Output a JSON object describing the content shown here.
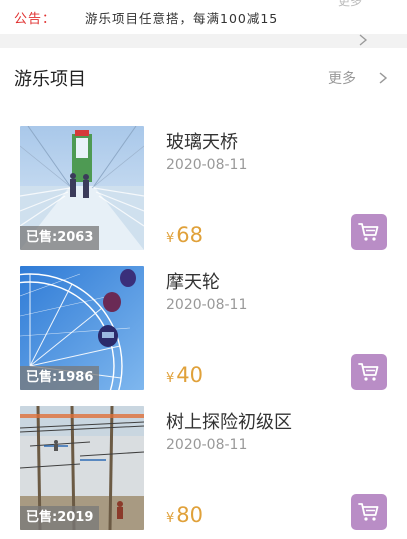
{
  "notice": {
    "label": "公告：",
    "text": "游乐项目任意搭，每满100减15",
    "more_partial": "更多"
  },
  "section": {
    "title": "游乐项目",
    "more": "更多"
  },
  "items": [
    {
      "name": "玻璃天桥",
      "date": "2020-08-11",
      "currency": "¥",
      "price": "68",
      "sold": "已售:2063",
      "image": "glass-bridge"
    },
    {
      "name": "摩天轮",
      "date": "2020-08-11",
      "currency": "¥",
      "price": "40",
      "sold": "已售:1986",
      "image": "ferris-wheel"
    },
    {
      "name": "树上探险初级区",
      "date": "2020-08-11",
      "currency": "¥",
      "price": "80",
      "sold": "已售:2019",
      "image": "tree-adventure"
    }
  ],
  "colors": {
    "accent_price": "#e0a13a",
    "cart_button": "#b98dc6",
    "notice_label": "#e0302f"
  },
  "icons": [
    "chevron-right-icon",
    "cart-icon"
  ]
}
